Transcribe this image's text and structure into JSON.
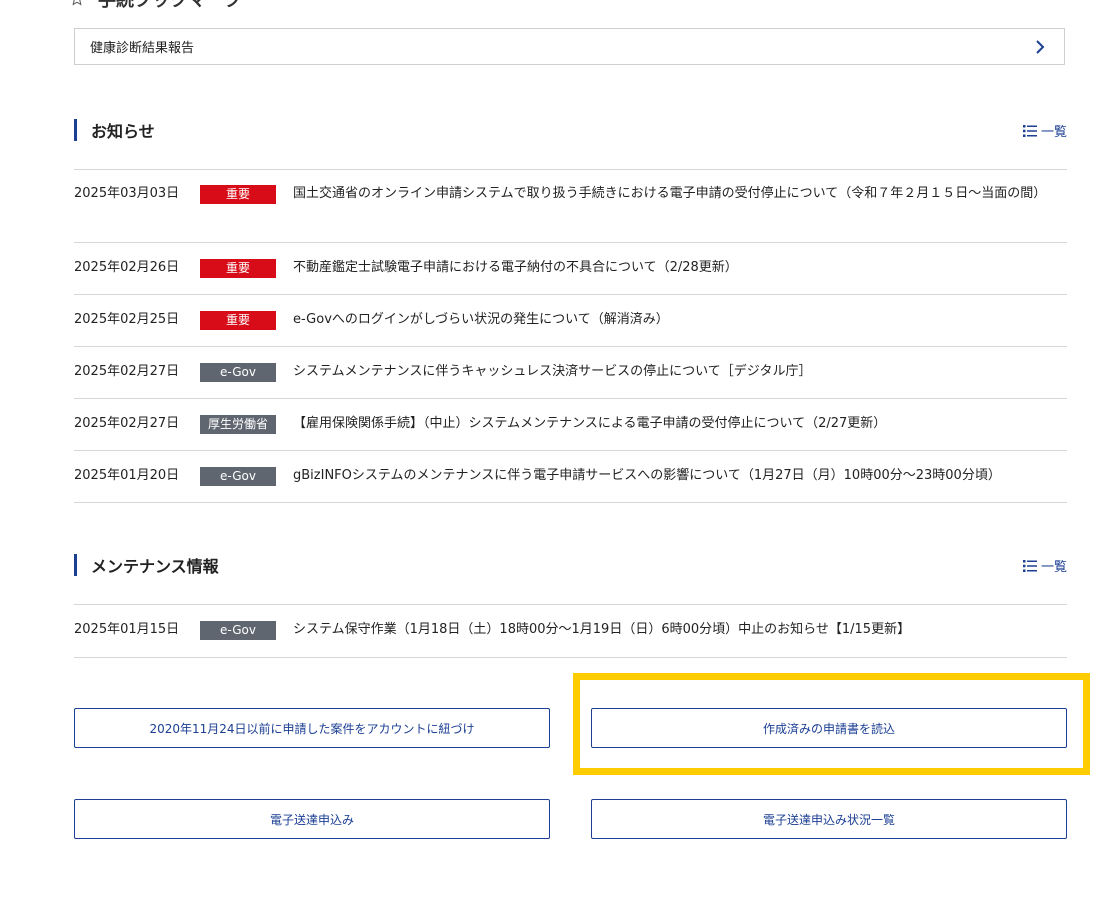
{
  "procedures": {
    "heading": "手続ブックマーク",
    "link_label": "健康診断結果報告"
  },
  "notices": {
    "title": "お知らせ",
    "list_link": "一覧",
    "items": [
      {
        "date": "2025年03月03日",
        "badge": "重要",
        "badge_type": "red",
        "text": "国土交通省のオンライン申請システムで取り扱う手続きにおける電子申請の受付停止について（令和７年２月１５日～当面の間）"
      },
      {
        "date": "2025年02月26日",
        "badge": "重要",
        "badge_type": "red",
        "text": "不動産鑑定士試験電子申請における電子納付の不具合について（2/28更新）"
      },
      {
        "date": "2025年02月25日",
        "badge": "重要",
        "badge_type": "red",
        "text": "e-Govへのログインがしづらい状況の発生について（解消済み）"
      },
      {
        "date": "2025年02月27日",
        "badge": "e-Gov",
        "badge_type": "gray",
        "text": "システムメンテナンスに伴うキャッシュレス決済サービスの停止について［デジタル庁］"
      },
      {
        "date": "2025年02月27日",
        "badge": "厚生労働省",
        "badge_type": "gray",
        "text": "【雇用保険関係手続】（中止）システムメンテナンスによる電子申請の受付停止について（2/27更新）"
      },
      {
        "date": "2025年01月20日",
        "badge": "e-Gov",
        "badge_type": "gray",
        "text": "gBizINFOシステムのメンテナンスに伴う電子申請サービスへの影響について（1月27日（月）10時00分～23時00分頃）"
      }
    ]
  },
  "maintenance": {
    "title": "メンテナンス情報",
    "list_link": "一覧",
    "items": [
      {
        "date": "2025年01月15日",
        "badge": "e-Gov",
        "badge_type": "gray",
        "text": "システム保守作業（1月18日（土）18時00分～1月19日（日）6時00分頃）中止のお知らせ【1/15更新】"
      }
    ]
  },
  "buttons": {
    "link_account": "2020年11月24日以前に申請した案件をアカウントに紐づけ",
    "load_application": "作成済みの申請書を読込",
    "e_submission": "電子送達申込み",
    "e_submission_status": "電子送達申込み状況一覧"
  },
  "colors": {
    "accent": "#1c3f94",
    "badge_red": "#d70c18",
    "badge_gray": "#5f6670",
    "highlight": "#ffcc00"
  }
}
